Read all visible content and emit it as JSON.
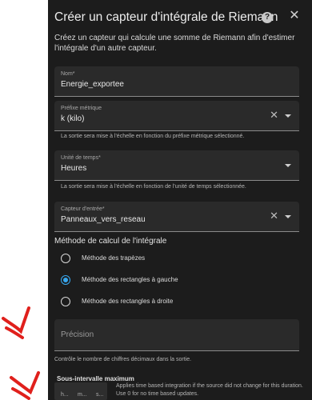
{
  "dialog": {
    "title": "Créer un capteur d'intégrale de Riemann",
    "help_glyph": "?",
    "close_glyph": "✕",
    "intro": "Créez un capteur qui calcule une somme de Riemann afin d'estimer l'intégrale d'un autre capteur."
  },
  "fields": {
    "name": {
      "label": "Nom*",
      "value": "Energie_exportee"
    },
    "metric_prefix": {
      "label": "Préfixe métrique",
      "value": "k (kilo)",
      "clear_glyph": "✕",
      "helper": "La sortie sera mise à l'échelle en fonction du préfixe métrique sélectionné."
    },
    "time_unit": {
      "label": "Unité de temps*",
      "value": "Heures",
      "helper": "La sortie sera mise à l'échelle en fonction de l'unité de temps sélectionnée."
    },
    "input_sensor": {
      "label": "Capteur d'entrée*",
      "value": "Panneaux_vers_reseau",
      "clear_glyph": "✕"
    }
  },
  "method": {
    "title": "Méthode de calcul de l'intégrale",
    "options": [
      {
        "label": "Méthode des trapèzes",
        "checked": false
      },
      {
        "label": "Méthode des rectangles à gauche",
        "checked": true
      },
      {
        "label": "Méthode des rectangles à droite",
        "checked": false
      }
    ]
  },
  "precision": {
    "placeholder": "Précision",
    "helper": "Contrôle le nombre de chiffres décimaux dans la sortie."
  },
  "sub_interval": {
    "title": "Sous-intervalle maximum",
    "units": [
      "h...",
      "m...",
      "s..."
    ],
    "helper": "Applies time based integration if the source did not change for this duration. Use 0 for no time based updates."
  },
  "colors": {
    "accent": "#38a8f0",
    "dialog_bg": "#1c1c1c",
    "annotation_arrow": "#e0201c"
  }
}
